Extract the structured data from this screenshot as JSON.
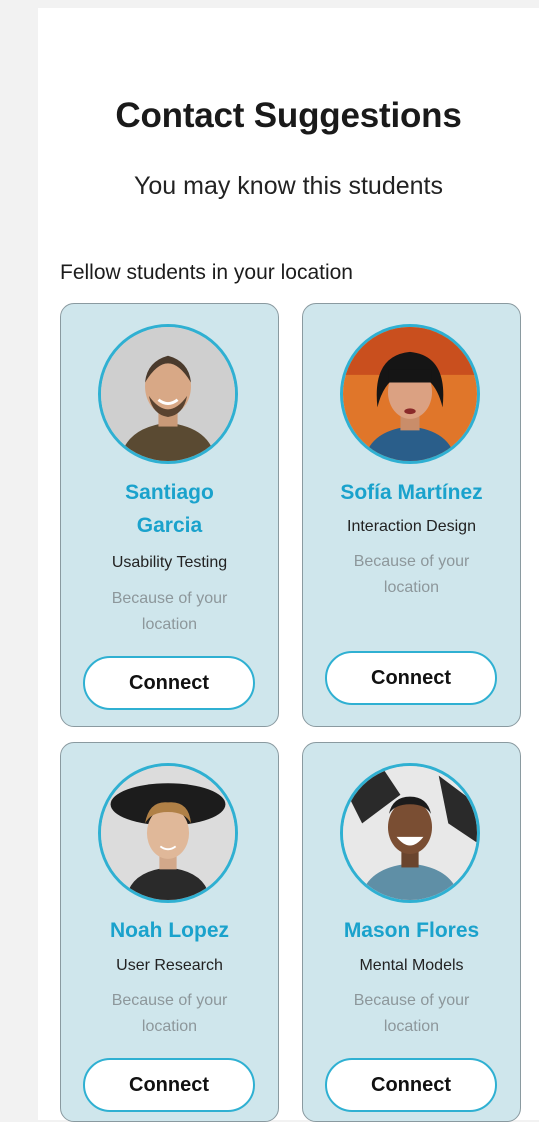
{
  "page": {
    "title": "Contact Suggestions",
    "subtitle": "You may know this students",
    "section_label": "Fellow students in your location"
  },
  "colors": {
    "accent": "#1aa2cc",
    "card_background": "#cfe6ec",
    "card_border": "#8a9aa0",
    "button_border": "#2fb0d2"
  },
  "students": [
    {
      "name_line1": "Santiago",
      "name_line2": "Garcia",
      "role": "Usability Testing",
      "reason_line1": "Because of your",
      "reason_line2": "location",
      "button_label": "Connect"
    },
    {
      "name_line1": "Sofía Martínez",
      "role": "Interaction Design",
      "reason_line1": "Because of your",
      "reason_line2": "location",
      "button_label": "Connect"
    },
    {
      "name_line1": "Noah Lopez",
      "role": "User Research",
      "reason_line1": "Because of your",
      "reason_line2": "location",
      "button_label": "Connect"
    },
    {
      "name_line1": "Mason Flores",
      "role": "Mental Models",
      "reason_line1": "Because of your",
      "reason_line2": "location",
      "button_label": "Connect"
    }
  ]
}
